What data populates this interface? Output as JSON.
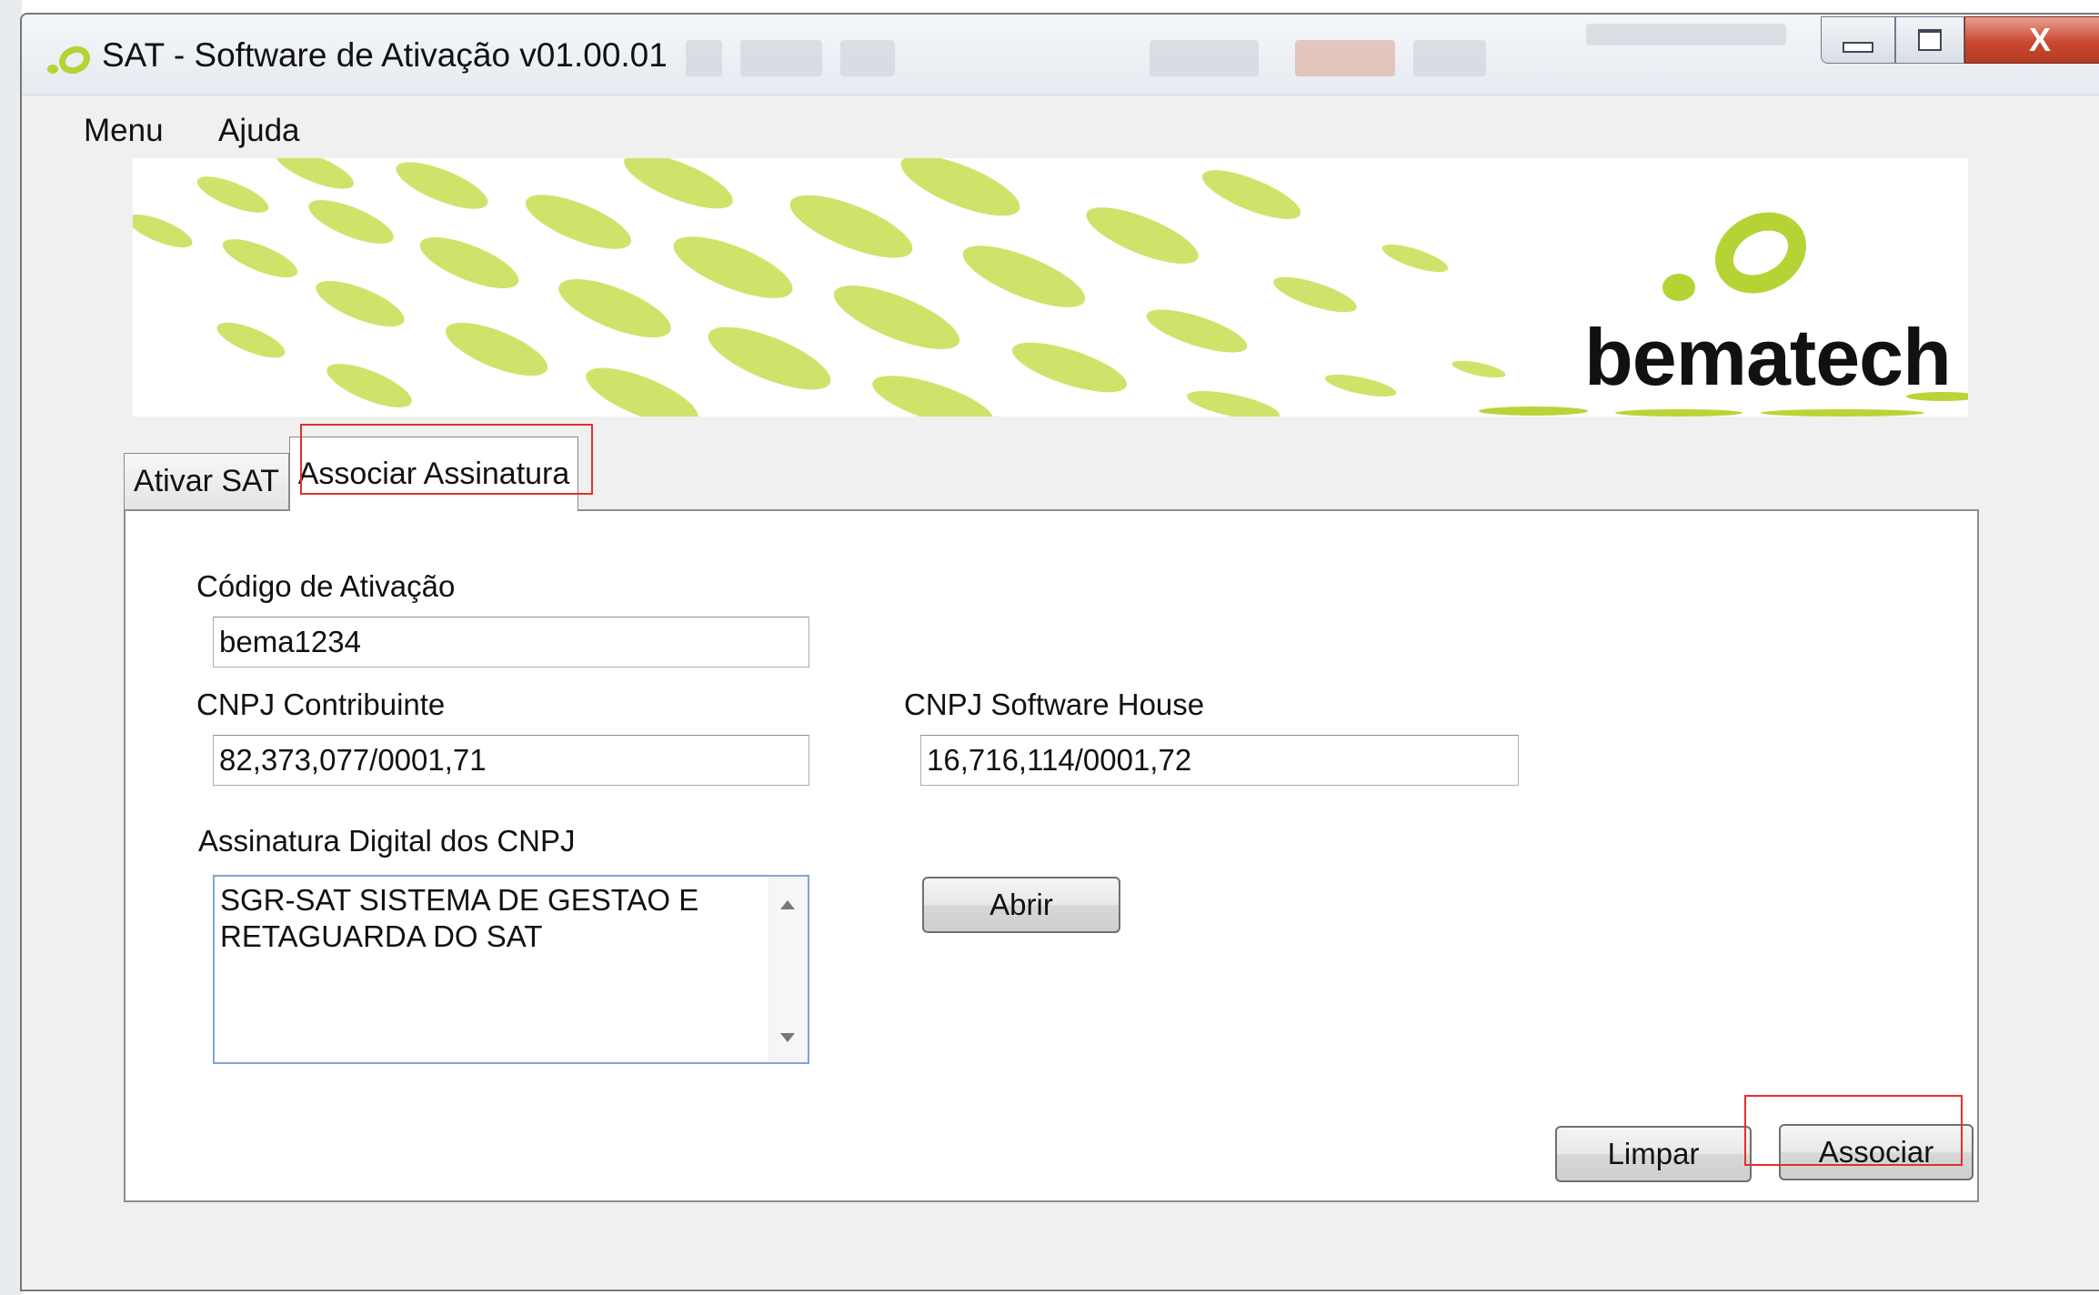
{
  "window": {
    "title": "SAT - Software de Ativação v01.00.01",
    "close_glyph": "X"
  },
  "menu": {
    "items": [
      "Menu",
      "Ajuda"
    ]
  },
  "banner": {
    "brand": "bematech",
    "accent_color": "#b5d334"
  },
  "tabs": [
    {
      "label": "Ativar SAT",
      "active": false
    },
    {
      "label": "Associar Assinatura",
      "active": true
    }
  ],
  "form": {
    "codigo_label": "Código de Ativação",
    "codigo_value": "bema1234",
    "cnpj_contribuinte_label": "CNPJ Contribuinte",
    "cnpj_contribuinte_value": "82,373,077/0001,71",
    "cnpj_sw_label": "CNPJ Software House",
    "cnpj_sw_value": "16,716,114/0001,72",
    "assinatura_label": "Assinatura Digital dos CNPJ",
    "assinatura_value": "SGR-SAT SISTEMA DE GESTAO E\nRETAGUARDA DO SAT"
  },
  "buttons": {
    "abrir": "Abrir",
    "limpar": "Limpar",
    "associar": "Associar"
  },
  "highlight_color": "#e03030"
}
